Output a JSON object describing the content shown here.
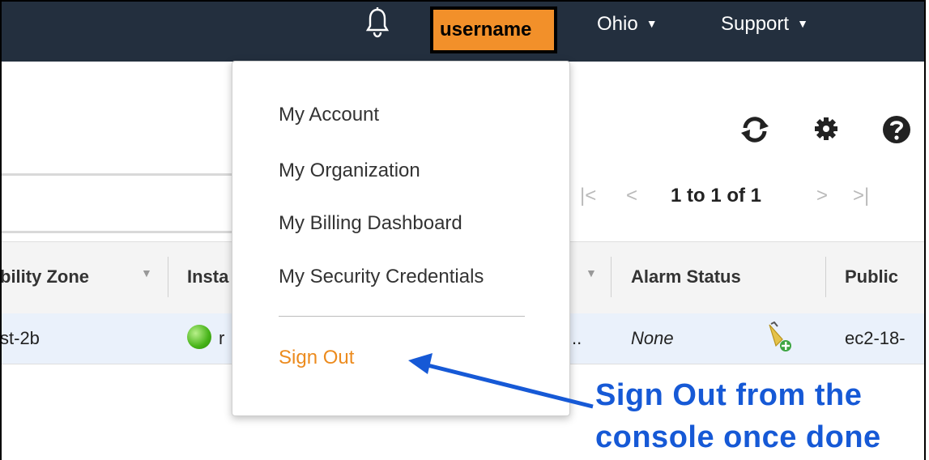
{
  "topbar": {
    "user_label": "username",
    "region_label": "Ohio",
    "support_label": "Support"
  },
  "pager": {
    "first": "|<",
    "prev": "<",
    "range": "1 to 1 of 1",
    "next": ">",
    "last": ">|"
  },
  "table": {
    "headers": [
      "bility Zone",
      "Insta",
      "Alarm Status",
      "Public"
    ],
    "row": {
      "zone": "st-2b",
      "instance_state_partial": "r",
      "truncated": "..",
      "alarm_status": "None",
      "public_dns": "ec2-18-"
    }
  },
  "user_menu": {
    "items": [
      "My Account",
      "My Organization",
      "My Billing Dashboard",
      "My Security Credentials"
    ],
    "sign_out": "Sign Out"
  },
  "annotation": {
    "line1": "Sign Out from the",
    "line2": "console once done"
  },
  "colors": {
    "nav_bg": "#232f3e",
    "user_highlight": "#f2902a",
    "sign_out": "#ec8b1e",
    "annotation": "#1659d6"
  }
}
